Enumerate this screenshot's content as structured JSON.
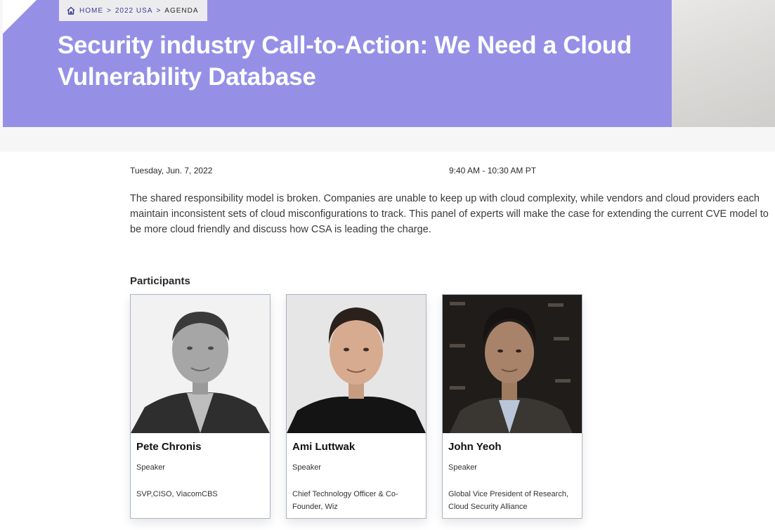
{
  "breadcrumb": {
    "home": "HOME",
    "event": "2022 USA",
    "current": "AGENDA"
  },
  "session": {
    "title": "Security industry Call-to-Action: We Need a Cloud Vulnerability Database",
    "date": "Tuesday, Jun. 7, 2022",
    "time": "9:40 AM - 10:30 AM PT",
    "description": "The shared responsibility model is broken. Companies are unable to keep up with cloud complexity, while vendors and cloud providers each maintain inconsistent sets of cloud misconfigurations to track. This panel of experts will make the case for extending the current CVE model to be more cloud friendly and discuss how CSA is leading the charge."
  },
  "participants": {
    "heading": "Participants",
    "items": [
      {
        "name": "Pete Chronis",
        "role": "Speaker",
        "org": "SVP,CISO, ViacomCBS"
      },
      {
        "name": "Ami Luttwak",
        "role": "Speaker",
        "org": "Chief Technology Officer & Co-Founder, Wiz"
      },
      {
        "name": "John Yeoh",
        "role": "Speaker",
        "org": "Global Vice President of Research, Cloud Security Alliance"
      }
    ]
  },
  "colors": {
    "hero": "#9590e6",
    "breadcrumb_text": "#3b3a8f",
    "card_border": "#a9b3c4"
  }
}
